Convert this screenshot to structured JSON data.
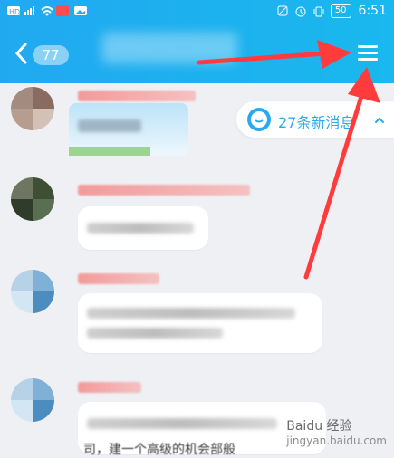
{
  "status": {
    "left_icons": [
      "hd-icon",
      "4g-signal-icon",
      "wifi-icon",
      "app-badge-icon",
      "image-icon"
    ],
    "right_icons": [
      "no-sim-icon",
      "alarm-icon",
      "vibrate-icon"
    ],
    "battery": "50",
    "time": "6:51"
  },
  "header": {
    "unread_count": "77"
  },
  "chat": {
    "new_messages": "27条新消息"
  },
  "footer": {
    "blur_text": "司，建一个高级的机会部般"
  },
  "watermark": {
    "brand": "Baidu 经验",
    "url": "jingyan.baidu.com"
  },
  "colors": {
    "header": "#1daef0",
    "accent": "#2aa9ef",
    "annotation": "#ff3b3b"
  }
}
